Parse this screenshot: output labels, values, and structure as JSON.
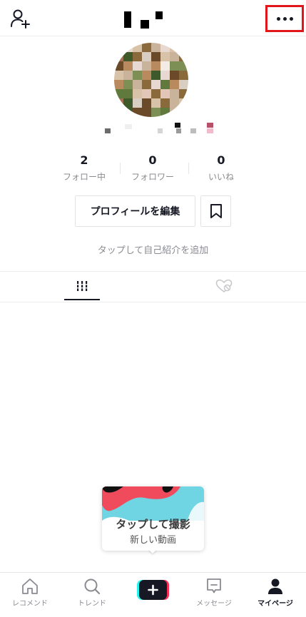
{
  "header": {
    "add_user_icon": "person-add-icon",
    "more_icon": "more-horizontal-icon",
    "highlight_color": "#e1161b"
  },
  "profile": {
    "stats": [
      {
        "value": "2",
        "label": "フォロー中"
      },
      {
        "value": "0",
        "label": "フォロワー"
      },
      {
        "value": "0",
        "label": "いいね"
      }
    ],
    "edit_button_label": "プロフィールを編集",
    "bookmark_icon": "bookmark-icon",
    "bio_placeholder": "タップして自己紹介を追加"
  },
  "tabs": [
    {
      "icon": "videos-grid-icon",
      "active": true
    },
    {
      "icon": "liked-heart-icon",
      "active": false
    }
  ],
  "record_prompt": {
    "title": "タップして撮影",
    "subtitle": "新しい動画"
  },
  "bottom_nav": [
    {
      "label": "レコメンド",
      "icon": "home-icon"
    },
    {
      "label": "トレンド",
      "icon": "search-icon"
    },
    {
      "label": "",
      "icon": "create-plus-icon"
    },
    {
      "label": "メッセージ",
      "icon": "inbox-icon"
    },
    {
      "label": "マイページ",
      "icon": "profile-icon",
      "active": true
    }
  ],
  "colors": {
    "text_primary": "#161823",
    "text_secondary": "#8a8b91",
    "brand_cyan": "#25f4ee",
    "brand_red": "#fe2c55"
  }
}
